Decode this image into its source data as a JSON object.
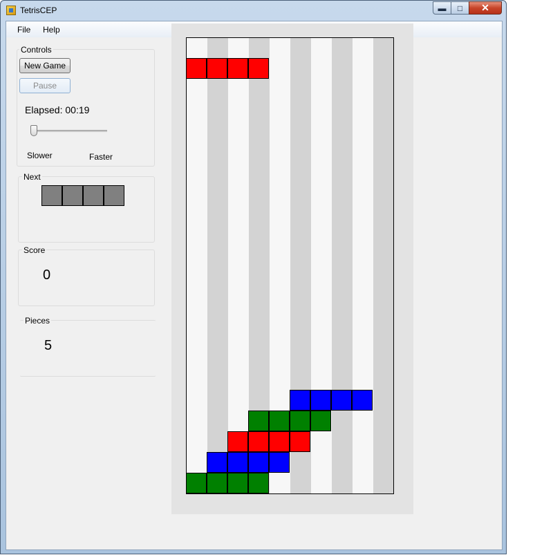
{
  "window": {
    "title": "TetrisCEP"
  },
  "menu": [
    {
      "label": "File"
    },
    {
      "label": "Help"
    }
  ],
  "controls": {
    "title": "Controls",
    "new_game": "New Game",
    "pause": "Pause",
    "elapsed": "Elapsed: 00:19",
    "slower": "Slower",
    "faster": "Faster",
    "speed_level": 0
  },
  "next": {
    "title": "Next",
    "piece": "I",
    "color": "#808080"
  },
  "score": {
    "title": "Score",
    "value": "0"
  },
  "pieces": {
    "title": "Pieces",
    "value": "5"
  },
  "board": {
    "columns": 10,
    "rows": 22,
    "stripe_colors": [
      "#f7f7f7",
      "#d3d3d3"
    ],
    "colors": {
      "R": "#ff0000",
      "G": "#008000",
      "B": "#0000ff"
    },
    "active_piece": {
      "type": "I",
      "color": "R",
      "row": 1,
      "col": 0
    },
    "grid": [
      "..........",
      "RRRR......",
      "..........",
      "..........",
      "..........",
      "..........",
      "..........",
      "..........",
      "..........",
      "..........",
      "..........",
      "..........",
      "..........",
      "..........",
      "..........",
      "..........",
      "..........",
      ".....BBBB.",
      "...GGGG...",
      "..RRRR....",
      ".BBBB.....",
      "GGGG......"
    ]
  }
}
